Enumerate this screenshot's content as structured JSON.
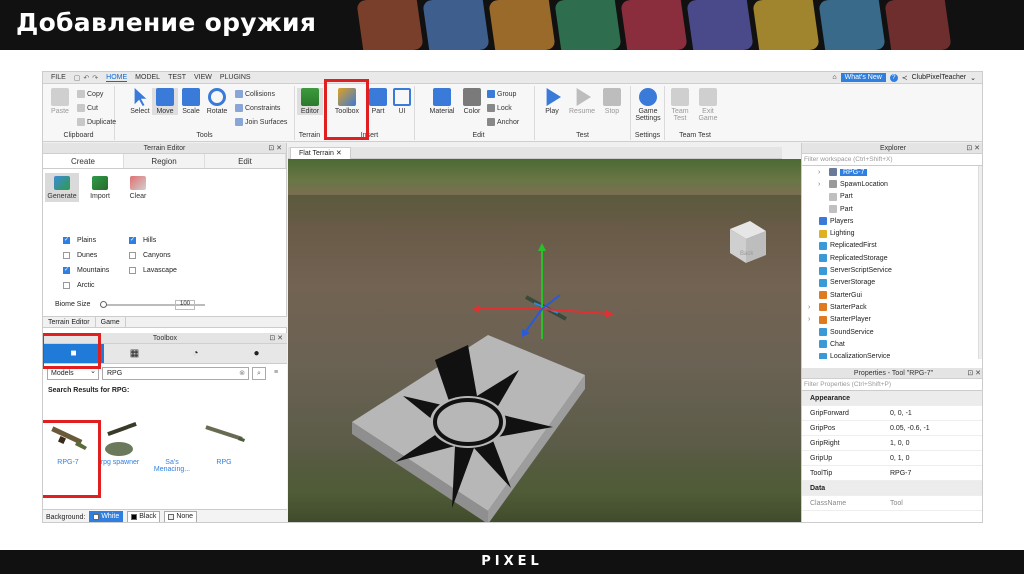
{
  "slide": {
    "title": "Добавление оружия",
    "footer_logo": "PIXEL"
  },
  "menu": {
    "items": [
      "FILE",
      "HOME",
      "MODEL",
      "TEST",
      "VIEW",
      "PLUGINS"
    ],
    "active": "HOME",
    "whats_new": "What's New",
    "username": "ClubPixelTeacher"
  },
  "ribbon": {
    "clipboard": {
      "label": "Clipboard",
      "paste": "Paste",
      "copy": "Copy",
      "cut": "Cut",
      "duplicate": "Duplicate"
    },
    "tools": {
      "label": "Tools",
      "select": "Select",
      "move": "Move",
      "scale": "Scale",
      "rotate": "Rotate",
      "collisions": "Collisions",
      "constraints": "Constraints",
      "join_surfaces": "Join Surfaces"
    },
    "terrain": {
      "label": "Terrain",
      "editor": "Editor"
    },
    "insert": {
      "label": "Insert",
      "toolbox": "Toolbox",
      "part": "Part",
      "ui": "UI"
    },
    "edit": {
      "label": "Edit",
      "material": "Material",
      "color": "Color",
      "group": "Group",
      "lock": "Lock",
      "anchor": "Anchor"
    },
    "test": {
      "label": "Test",
      "play": "Play",
      "resume": "Resume",
      "stop": "Stop"
    },
    "settings": {
      "label": "Settings",
      "game_settings_1": "Game",
      "game_settings_2": "Settings"
    },
    "team_test": {
      "label": "Team Test",
      "team_test_1": "Team",
      "team_test_2": "Test",
      "exit_game_1": "Exit",
      "exit_game_2": "Game"
    }
  },
  "terrain_editor": {
    "title": "Terrain Editor",
    "tabs": [
      "Create",
      "Region",
      "Edit"
    ],
    "tools": [
      "Generate",
      "Import",
      "Clear"
    ],
    "biomes": [
      {
        "label": "Plains",
        "checked": true
      },
      {
        "label": "Hills",
        "checked": true
      },
      {
        "label": "Dunes",
        "checked": false
      },
      {
        "label": "Canyons",
        "checked": false
      },
      {
        "label": "Mountains",
        "checked": true
      },
      {
        "label": "Lavascape",
        "checked": false
      },
      {
        "label": "Arctic",
        "checked": false
      }
    ],
    "biome_size_label": "Biome Size",
    "biome_size_value": "100",
    "bottom_tabs": [
      "Terrain Editor",
      "Game"
    ]
  },
  "toolbox": {
    "title": "Toolbox",
    "category": "Models",
    "search_value": "RPG",
    "results_prefix": "Search Results for ",
    "results_query": "RPG:",
    "assets": [
      "RPG-7",
      "rpg spawner",
      "Sa's Menacing...",
      "RPG"
    ],
    "background_label": "Background:",
    "background_options": [
      "White",
      "Black",
      "None"
    ]
  },
  "viewport": {
    "tab_label": "Flat Terrain",
    "spawn_text": "Back"
  },
  "explorer": {
    "title": "Explorer",
    "filter_placeholder": "Filter workspace (Ctrl+Shift+X)",
    "nodes": [
      {
        "label": "RPG-7",
        "selected": true,
        "expander": "›",
        "indent": 1
      },
      {
        "label": "SpawnLocation",
        "selected": false,
        "expander": "›",
        "indent": 1
      },
      {
        "label": "Part",
        "selected": false,
        "expander": "",
        "indent": 1
      },
      {
        "label": "Part",
        "selected": false,
        "expander": "",
        "indent": 1
      },
      {
        "label": "Players",
        "selected": false,
        "expander": "",
        "indent": 0
      },
      {
        "label": "Lighting",
        "selected": false,
        "expander": "",
        "indent": 0
      },
      {
        "label": "ReplicatedFirst",
        "selected": false,
        "expander": "",
        "indent": 0
      },
      {
        "label": "ReplicatedStorage",
        "selected": false,
        "expander": "",
        "indent": 0
      },
      {
        "label": "ServerScriptService",
        "selected": false,
        "expander": "",
        "indent": 0
      },
      {
        "label": "ServerStorage",
        "selected": false,
        "expander": "",
        "indent": 0
      },
      {
        "label": "StarterGui",
        "selected": false,
        "expander": "",
        "indent": 0
      },
      {
        "label": "StarterPack",
        "selected": false,
        "expander": "›",
        "indent": 0
      },
      {
        "label": "StarterPlayer",
        "selected": false,
        "expander": "›",
        "indent": 0
      },
      {
        "label": "SoundService",
        "selected": false,
        "expander": "",
        "indent": 0
      },
      {
        "label": "Chat",
        "selected": false,
        "expander": "",
        "indent": 0
      },
      {
        "label": "LocalizationService",
        "selected": false,
        "expander": "",
        "indent": 0
      }
    ]
  },
  "properties": {
    "title": "Properties - Tool \"RPG-7\"",
    "filter_placeholder": "Filter Properties (Ctrl+Shift+P)",
    "rows": [
      {
        "type": "cat",
        "name": "Appearance",
        "value": ""
      },
      {
        "type": "prop",
        "name": "GripForward",
        "value": "0, 0, -1"
      },
      {
        "type": "prop",
        "name": "GripPos",
        "value": "0.05, -0.6, -1"
      },
      {
        "type": "prop",
        "name": "GripRight",
        "value": "1, 0, 0"
      },
      {
        "type": "prop",
        "name": "GripUp",
        "value": "0, 1, 0"
      },
      {
        "type": "prop",
        "name": "ToolTip",
        "value": "RPG-7"
      },
      {
        "type": "cat",
        "name": "Data",
        "value": ""
      },
      {
        "type": "dim",
        "name": "ClassName",
        "value": "Tool"
      }
    ]
  },
  "colors": {
    "accent": "#2f7fe0",
    "highlight_box": "#e02020",
    "slide_bar": "#111111"
  }
}
